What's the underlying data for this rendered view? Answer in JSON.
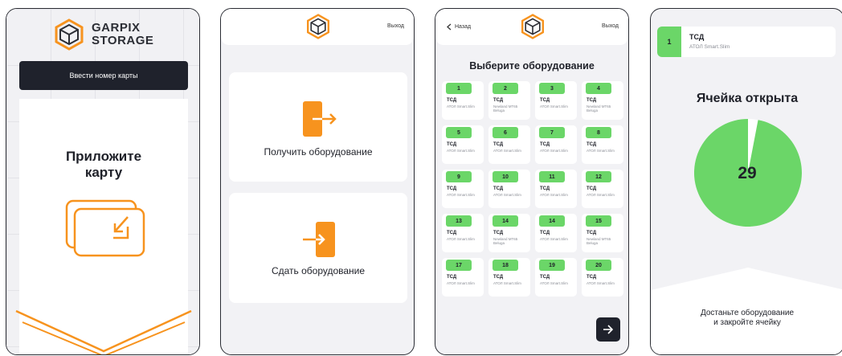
{
  "colors": {
    "accent": "#f7931e",
    "green": "#6bd668",
    "dark": "#1f222c",
    "screen_bg": "#f2f2f5"
  },
  "screen1": {
    "brand_line1": "GARPIX",
    "brand_line2": "STORAGE",
    "enter_card_button": "Ввести номер карты",
    "attach_line1": "Приложите",
    "attach_line2": "карту",
    "logo_icon": "cube-logo-icon",
    "card_icon": "card-tap-icon"
  },
  "screen2": {
    "exit_label": "Выход",
    "receive_label": "Получить оборудование",
    "return_label": "Сдать оборудование",
    "receive_icon": "door-enter-icon",
    "return_icon": "door-exit-icon"
  },
  "screen3": {
    "back_label": "Назад",
    "exit_label": "Выход",
    "title": "Выберите оборудование",
    "cells": [
      {
        "num": "1",
        "type": "ТСД",
        "model": "АТОЛ Smart.Slim"
      },
      {
        "num": "2",
        "type": "ТСД",
        "model": "Newland MT65 Beluga"
      },
      {
        "num": "3",
        "type": "ТСД",
        "model": "АТОЛ Smart.Slim"
      },
      {
        "num": "4",
        "type": "ТСД",
        "model": "Newland MT65 Beluga"
      },
      {
        "num": "5",
        "type": "ТСД",
        "model": "АТОЛ Smart.Slim"
      },
      {
        "num": "6",
        "type": "ТСД",
        "model": "АТОЛ Smart.Slim"
      },
      {
        "num": "7",
        "type": "ТСД",
        "model": "АТОЛ Smart.Slim"
      },
      {
        "num": "8",
        "type": "ТСД",
        "model": "АТОЛ Smart.Slim"
      },
      {
        "num": "9",
        "type": "ТСД",
        "model": "АТОЛ Smart.Slim"
      },
      {
        "num": "10",
        "type": "ТСД",
        "model": "АТОЛ Smart.Slim"
      },
      {
        "num": "11",
        "type": "ТСД",
        "model": "АТОЛ Smart.Slim"
      },
      {
        "num": "12",
        "type": "ТСД",
        "model": "АТОЛ Smart.Slim"
      },
      {
        "num": "13",
        "type": "ТСД",
        "model": "АТОЛ Smart.Slim"
      },
      {
        "num": "14",
        "type": "ТСД",
        "model": "Newland MT65 Beluga"
      },
      {
        "num": "14",
        "type": "ТСД",
        "model": "АТОЛ Smart.Slim"
      },
      {
        "num": "15",
        "type": "ТСД",
        "model": "Newland MT65 Beluga"
      },
      {
        "num": "17",
        "type": "ТСД",
        "model": "АТОЛ Smart.Slim"
      },
      {
        "num": "18",
        "type": "ТСД",
        "model": "АТОЛ Smart.Slim"
      },
      {
        "num": "19",
        "type": "ТСД",
        "model": "АТОЛ Smart.Slim"
      },
      {
        "num": "20",
        "type": "ТСД",
        "model": "АТОЛ Smart.Slim"
      }
    ],
    "next_icon": "arrow-right-icon"
  },
  "screen4": {
    "selected_num": "1",
    "selected_type": "ТСД",
    "selected_model": "АТОЛ Smart.Slim",
    "opened_title": "Ячейка открыта",
    "countdown": "29",
    "countdown_fraction": 0.97,
    "take_line1": "Достаньте оборудование",
    "take_line2": "и закройте ячейку"
  }
}
